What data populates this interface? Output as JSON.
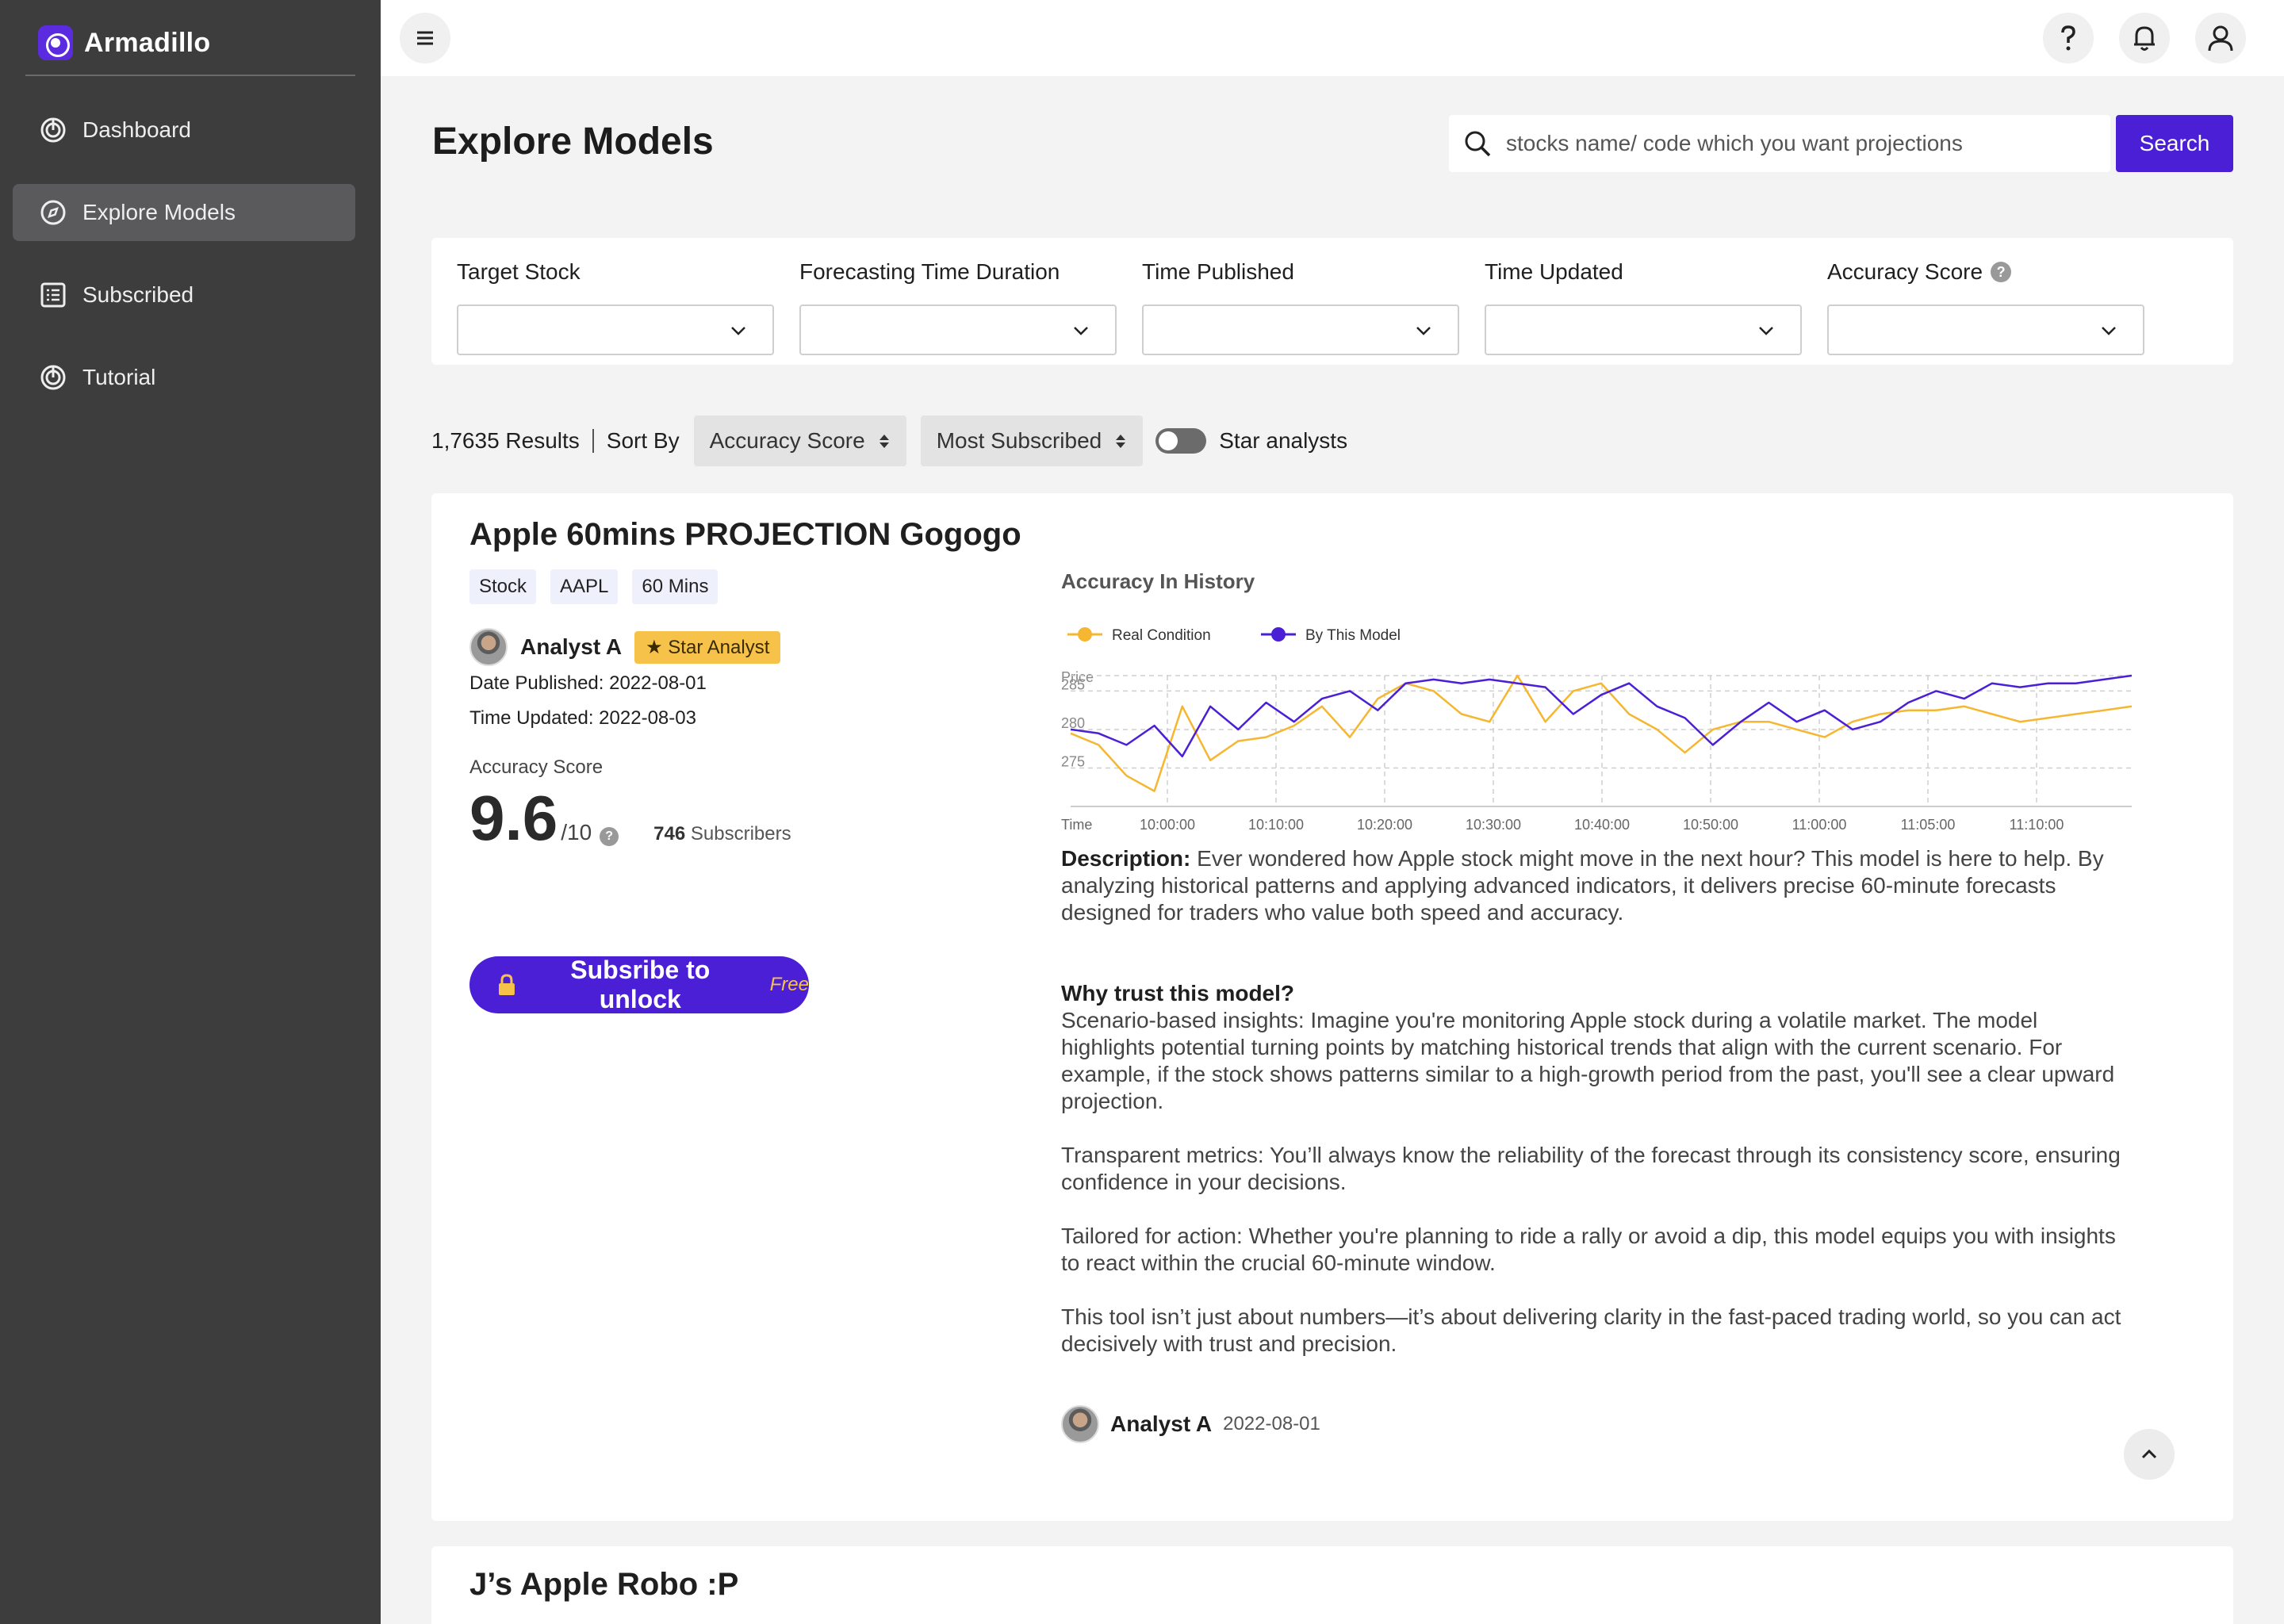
{
  "app": {
    "name": "Armadillo"
  },
  "sidebar": {
    "items": [
      {
        "label": "Dashboard",
        "icon": "dashboard-icon",
        "active": false
      },
      {
        "label": "Explore Models",
        "icon": "compass-icon",
        "active": true
      },
      {
        "label": "Subscribed",
        "icon": "list-icon",
        "active": false
      },
      {
        "label": "Tutorial",
        "icon": "tutorial-icon",
        "active": false
      }
    ]
  },
  "topbar": {
    "icons": [
      "menu-icon",
      "help-icon",
      "bell-icon",
      "user-icon"
    ]
  },
  "page": {
    "title": "Explore Models"
  },
  "search": {
    "placeholder": "stocks name/ code which you want projections",
    "value": "",
    "button_label": "Search"
  },
  "filters": [
    {
      "label": "Target Stock",
      "value": ""
    },
    {
      "label": "Forecasting Time Duration",
      "value": ""
    },
    {
      "label": "Time Published",
      "value": ""
    },
    {
      "label": "Time Updated",
      "value": ""
    },
    {
      "label": "Accuracy Score",
      "value": "",
      "help_icon": "?"
    }
  ],
  "results": {
    "count": "1,7635 Results",
    "sort_by_label": "Sort By",
    "sort1": "Accuracy Score",
    "sort2": "Most Subscribed",
    "toggle_label": "Star analysts",
    "toggle_on": false
  },
  "model": {
    "title": "Apple 60mins PROJECTION Gogogo",
    "tags": [
      "Stock",
      "AAPL",
      "60 Mins"
    ],
    "analyst": "Analyst A",
    "star_badge": "★ Star Analyst",
    "date_published": "Date Published: 2022-08-01",
    "time_updated": "Time Updated: 2022-08-03",
    "score_label": "Accuracy Score",
    "score": "9.6",
    "score_out_of": "/10",
    "subscribers_count": "746",
    "subscribers_label": "Subscribers",
    "unlock_label": "Subsribe to unlock",
    "unlock_free": "Free",
    "history_title": "Accuracy In History",
    "description_label": "Description:",
    "description": "Ever wondered how Apple stock might move in the next hour? This model is here to help. By analyzing historical patterns and applying advanced indicators, it delivers precise 60-minute forecasts designed for traders who value both speed and accuracy.",
    "why_title": "Why trust this model?",
    "why_paragraphs": [
      "Scenario-based insights: Imagine you're monitoring Apple stock during a volatile market. The model highlights potential turning points by matching historical trends that align with the current scenario. For example, if the stock shows patterns similar to a high-growth period from the past, you'll see a clear upward projection.",
      "Transparent metrics: You’ll always know the reliability of the forecast through its consistency score, ensuring confidence in your decisions.",
      "Tailored for action: Whether you're planning to ride a rally or avoid a dip, this model equips you with insights to react within the crucial 60-minute window.",
      "This tool isn’t just about numbers—it’s about delivering clarity in the fast-paced trading world, so you can act decisively with trust and precision."
    ],
    "footer_analyst": "Analyst A",
    "footer_date": "2022-08-01"
  },
  "next_model": {
    "title": "J’s Apple Robo :P"
  },
  "colors": {
    "accent": "#4a1fd6",
    "real": "#f5b731",
    "model": "#4a1fd6",
    "sidebar": "#3d3d3e"
  },
  "chart_data": {
    "type": "line",
    "ylabel": "Price",
    "xlabel": "Time",
    "yticks": [
      285,
      280,
      275
    ],
    "ylim": [
      270,
      287
    ],
    "x_tick_labels": [
      "10:00:00",
      "10:10:00",
      "10:20:00",
      "10:30:00",
      "10:40:00",
      "10:50:00",
      "11:00:00",
      "11:05:00",
      "11:10:00"
    ],
    "grid": true,
    "legend_position": "top-left",
    "series": [
      {
        "name": "Real Condition",
        "color": "#f5b731",
        "values": [
          279.5,
          278,
          274,
          272,
          283,
          276,
          278.5,
          279,
          280.5,
          283,
          279,
          284,
          286,
          285,
          282,
          281,
          287,
          281,
          285,
          286,
          282,
          280,
          277,
          280,
          281,
          281,
          280,
          279,
          281,
          282,
          282.5,
          282.5,
          283,
          282,
          281,
          281.5,
          282,
          282.5,
          283
        ]
      },
      {
        "name": "By This Model",
        "color": "#4a1fd6",
        "values": [
          280,
          279.5,
          278,
          280.5,
          276.5,
          283,
          280,
          283.5,
          281,
          284,
          285,
          282.5,
          286,
          286.5,
          286,
          286.5,
          286,
          285.5,
          282,
          284.5,
          286,
          283,
          281.5,
          278,
          281,
          283.5,
          281,
          282.5,
          280,
          281,
          283.5,
          285,
          284,
          286,
          285.5,
          286,
          286,
          286.5,
          287
        ]
      }
    ]
  }
}
